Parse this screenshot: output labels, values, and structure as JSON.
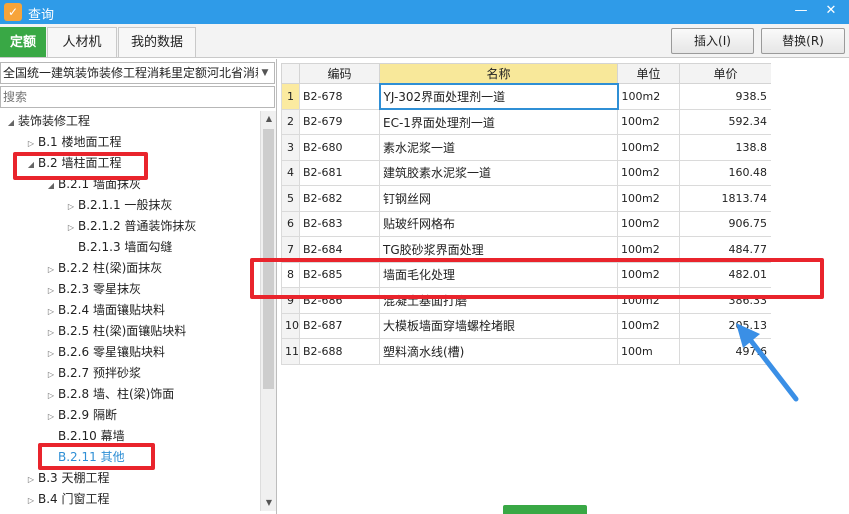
{
  "window": {
    "title": "查询",
    "minimize": "—",
    "close": "✕"
  },
  "tabs": [
    {
      "label": "定额",
      "active": true
    },
    {
      "label": "人材机",
      "active": false
    },
    {
      "label": "我的数据",
      "active": false
    }
  ],
  "actions": {
    "insert": "插入(I)",
    "replace": "替换(R)"
  },
  "library": {
    "selected": "全国统一建筑装饰装修工程消耗里定额河北省消耗"
  },
  "search": {
    "placeholder": "搜索"
  },
  "tree": [
    {
      "label": "装饰装修工程",
      "toggle": "◢"
    },
    {
      "label": "B.1 楼地面工程",
      "toggle": "▷"
    },
    {
      "label": "B.2 墙柱面工程",
      "toggle": "◢"
    },
    {
      "label": "B.2.1 墙面抹灰",
      "toggle": "◢"
    },
    {
      "label": "B.2.1.1 一般抹灰",
      "toggle": "▷"
    },
    {
      "label": "B.2.1.2 普通装饰抹灰",
      "toggle": "▷"
    },
    {
      "label": "B.2.1.3 墙面勾缝",
      "toggle": ""
    },
    {
      "label": "B.2.2 柱(梁)面抹灰",
      "toggle": "▷"
    },
    {
      "label": "B.2.3 零星抹灰",
      "toggle": "▷"
    },
    {
      "label": "B.2.4 墙面镶贴块料",
      "toggle": "▷"
    },
    {
      "label": "B.2.5 柱(梁)面镶贴块料",
      "toggle": "▷"
    },
    {
      "label": "B.2.6 零星镶贴块料",
      "toggle": "▷"
    },
    {
      "label": "B.2.7 预拌砂浆",
      "toggle": "▷"
    },
    {
      "label": "B.2.8 墙、柱(梁)饰面",
      "toggle": "▷"
    },
    {
      "label": "B.2.9 隔断",
      "toggle": "▷"
    },
    {
      "label": "B.2.10 幕墙",
      "toggle": ""
    },
    {
      "label": "B.2.11 其他",
      "toggle": "",
      "selected": true
    },
    {
      "label": "B.3 天棚工程",
      "toggle": "▷"
    },
    {
      "label": "B.4 门窗工程",
      "toggle": "▷"
    }
  ],
  "table": {
    "headers": {
      "code": "编码",
      "name": "名称",
      "unit": "单位",
      "price": "单价"
    },
    "rows": [
      {
        "idx": "1",
        "code": "B2-678",
        "name": "YJ-302界面处理剂一道",
        "unit": "100m2",
        "price": "938.5"
      },
      {
        "idx": "2",
        "code": "B2-679",
        "name": "EC-1界面处理剂一道",
        "unit": "100m2",
        "price": "592.34"
      },
      {
        "idx": "3",
        "code": "B2-680",
        "name": "素水泥浆一道",
        "unit": "100m2",
        "price": "138.8"
      },
      {
        "idx": "4",
        "code": "B2-681",
        "name": "建筑胶素水泥浆一道",
        "unit": "100m2",
        "price": "160.48"
      },
      {
        "idx": "5",
        "code": "B2-682",
        "name": "钉钢丝网",
        "unit": "100m2",
        "price": "1813.74"
      },
      {
        "idx": "6",
        "code": "B2-683",
        "name": "贴玻纤网格布",
        "unit": "100m2",
        "price": "906.75"
      },
      {
        "idx": "7",
        "code": "B2-684",
        "name": "TG胶砂浆界面处理",
        "unit": "100m2",
        "price": "484.77"
      },
      {
        "idx": "8",
        "code": "B2-685",
        "name": "墙面毛化处理",
        "unit": "100m2",
        "price": "482.01"
      },
      {
        "idx": "9",
        "code": "B2-686",
        "name": "混凝土基面打磨",
        "unit": "100m2",
        "price": "386.33"
      },
      {
        "idx": "10",
        "code": "B2-687",
        "name": "大模板墙面穿墙螺栓堵眼",
        "unit": "100m2",
        "price": "205.13"
      },
      {
        "idx": "11",
        "code": "B2-688",
        "name": "塑料滴水线(槽)",
        "unit": "100m",
        "price": "497.6"
      }
    ]
  },
  "colors": {
    "titlebar": "#2f9be8",
    "active_tab": "#39a845",
    "annotation": "#e9242c",
    "pointer": "#3a8fe6"
  }
}
